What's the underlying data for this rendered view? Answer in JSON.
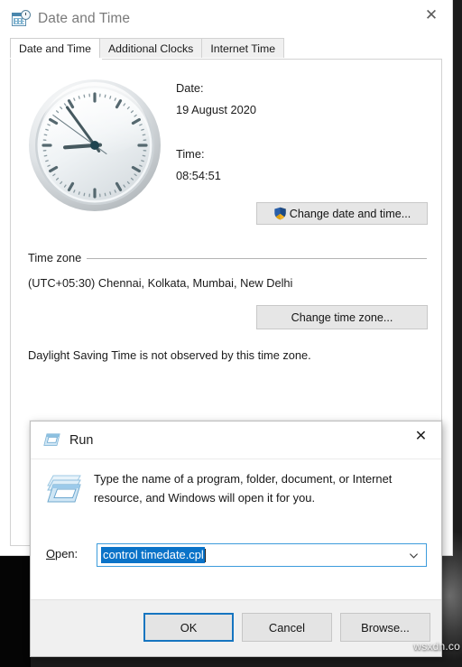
{
  "window": {
    "title": "Date and Time",
    "icon": "calendar-clock-icon",
    "close_label": "✕"
  },
  "tabs": [
    {
      "label": "Date and Time",
      "active": true
    },
    {
      "label": "Additional Clocks",
      "active": false
    },
    {
      "label": "Internet Time",
      "active": false
    }
  ],
  "datetime_panel": {
    "clock_icon": "analog-clock-graphic",
    "date_label": "Date:",
    "date_value": "19 August 2020",
    "time_label": "Time:",
    "time_value": "08:54:51",
    "change_datetime_button": "Change date and time...",
    "shield_icon": "uac-shield-icon",
    "clock_hands": {
      "hour_deg": 266,
      "minute_deg": 324,
      "second_deg": 306
    }
  },
  "timezone": {
    "group_label": "Time zone",
    "value": "(UTC+05:30) Chennai, Kolkata, Mumbai, New Delhi",
    "change_button": "Change time zone...",
    "dst_note": "Daylight Saving Time is not observed by this time zone."
  },
  "run_dialog": {
    "title": "Run",
    "title_icon": "run-window-icon",
    "close_label": "✕",
    "big_icon": "run-window-icon-large",
    "description": "Type the name of a program, folder, document, or Internet resource, and Windows will open it for you.",
    "open_label_prefix": "O",
    "open_label_rest": "pen:",
    "open_value": "control timedate.cpl",
    "open_value_selected": true,
    "dropdown_icon": "chevron-down-icon",
    "buttons": [
      {
        "label": "OK",
        "default": true,
        "accel": ""
      },
      {
        "label": "Cancel",
        "default": false,
        "accel": ""
      },
      {
        "label": "Browse...",
        "default": false,
        "accel": "B"
      }
    ]
  },
  "watermark": {
    "text": "wsxdn.co"
  },
  "colors": {
    "accent_blue": "#0a73c8",
    "focus_border": "#1675c0",
    "combo_border": "#3d9cdc",
    "button_face": "#e4e4e4",
    "title_gray": "#7a7a7a"
  }
}
